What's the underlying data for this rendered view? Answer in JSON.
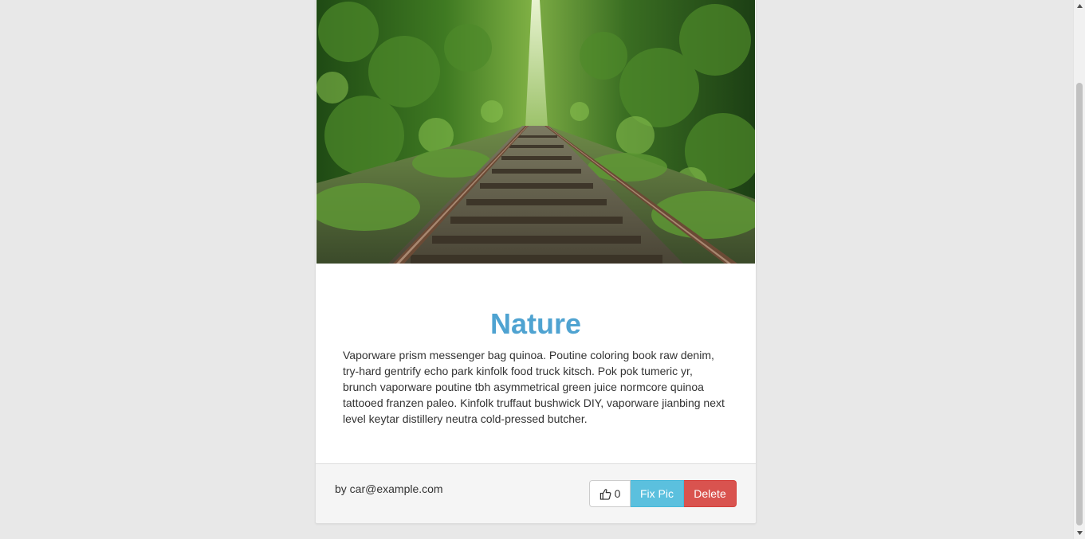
{
  "post": {
    "title": "Nature",
    "body": "Vaporware prism messenger bag quinoa. Poutine coloring book raw denim, try-hard gentrify echo park kinfolk food truck kitsch. Pok pok tumeric yr, brunch vaporware poutine tbh asymmetrical green juice normcore quinoa tattooed franzen paleo. Kinfolk truffaut bushwick DIY, vaporware jianbing next level keytar distillery neutra cold-pressed butcher.",
    "author": "by car@example.com",
    "image": "forest-railway-tracks-photo"
  },
  "actions": {
    "like_icon": "thumbs-up-icon",
    "like_count": "0",
    "fix_label": "Fix Pic",
    "delete_label": "Delete"
  },
  "colors": {
    "title": "#4fa3d1",
    "info": "#5bc0de",
    "danger": "#d9534f",
    "background": "#e8e8e8",
    "footer": "#f5f5f5"
  }
}
